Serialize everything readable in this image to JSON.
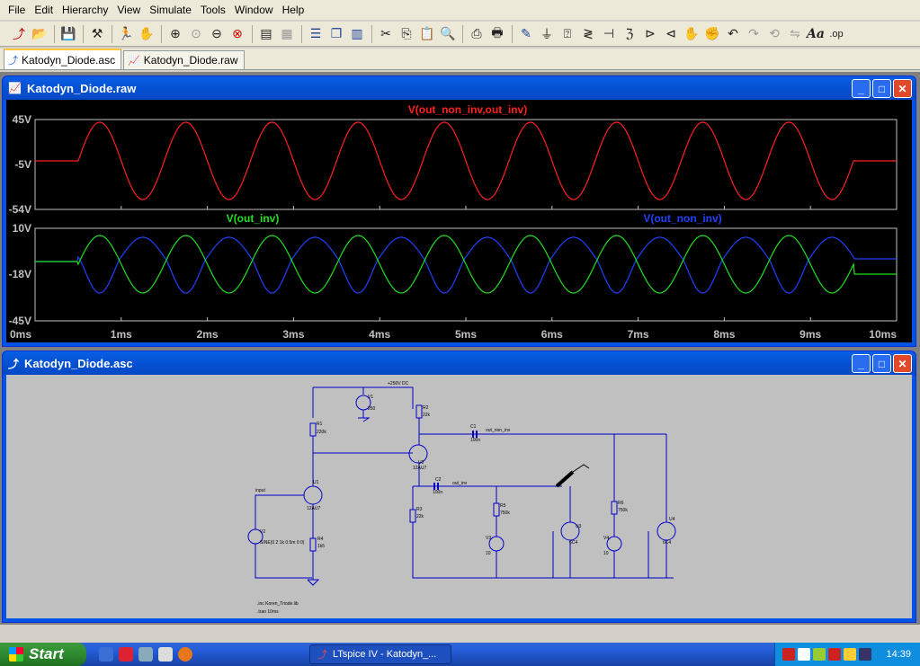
{
  "menu": [
    "File",
    "Edit",
    "Hierarchy",
    "View",
    "Simulate",
    "Tools",
    "Window",
    "Help"
  ],
  "toolbar_icons": [
    "new-schematic",
    "open",
    "save",
    "control-panel",
    "run",
    "halt",
    "zoom-in",
    "zoom-pan",
    "zoom-out",
    "zoom-cancel",
    "autorange",
    "mark-unref",
    "tile-horizontal",
    "cascade",
    "tile-vertical",
    "cut",
    "copy",
    "paste",
    "find",
    "print-setup",
    "print",
    "wire",
    "ground",
    "label-net",
    "resistor",
    "capacitor",
    "inductor",
    "diode",
    "component",
    "move",
    "drag",
    "undo",
    "redo",
    "rotate",
    "mirror",
    "text",
    "spice-directive"
  ],
  "tabs": [
    {
      "label": "Katodyn_Diode.asc",
      "active": true
    },
    {
      "label": "Katodyn_Diode.raw",
      "active": false
    }
  ],
  "plot_window": {
    "title": "Katodyn_Diode.raw",
    "pane1": {
      "trace": "V(out_non_inv,out_inv)",
      "color": "#ff2020",
      "ticks": [
        "45V",
        "-5V",
        "-54V"
      ]
    },
    "pane2": {
      "traces": [
        {
          "label": "V(out_inv)",
          "color": "#20e020"
        },
        {
          "label": "V(out_non_inv)",
          "color": "#2040ff"
        }
      ],
      "ticks": [
        "10V",
        "-18V",
        "-45V"
      ]
    },
    "x_ticks": [
      "0ms",
      "1ms",
      "2ms",
      "3ms",
      "4ms",
      "5ms",
      "6ms",
      "7ms",
      "8ms",
      "9ms",
      "10ms"
    ]
  },
  "chart_data": [
    {
      "type": "line",
      "series": [
        {
          "name": "V(out_non_inv,out_inv)",
          "x_ms": [
            0,
            0.5,
            1.0,
            10.0
          ],
          "note": "sine ~1kHz starting at 0.5ms"
        }
      ],
      "y_ticks": [
        "45V",
        "-5V",
        "-54V"
      ],
      "ylim": [
        -54,
        45
      ],
      "xlim_ms": [
        0,
        10
      ]
    },
    {
      "type": "line",
      "series": [
        {
          "name": "V(out_inv)"
        },
        {
          "name": "V(out_non_inv)"
        }
      ],
      "y_ticks": [
        "10V",
        "-18V",
        "-45V"
      ],
      "ylim": [
        -45,
        10
      ],
      "xlim_ms": [
        0,
        10
      ]
    }
  ],
  "schematic_window": {
    "title": "Katodyn_Diode.asc",
    "labels": {
      "supply": "+250V DC",
      "v1": "V1",
      "v1_val": "250",
      "r1": "R1",
      "r1_val": "220k",
      "r2": "R2",
      "r2_val": "22k",
      "c1": "C1",
      "c1_val": "100n",
      "out_non_inv": "out_non_inv",
      "out_inv": "out_inv",
      "u1": "U1",
      "u1_val": "12AU7",
      "u2": "U2",
      "u2_val": "12AU7",
      "c2": "C2",
      "c2_val": "100n",
      "r3": "R3",
      "r3_val": "22k",
      "r4": "R4",
      "r4_val": "1k5",
      "r5": "R5",
      "r5_val": "750k",
      "r6": "R6",
      "r6_val": "750k",
      "v2": "V2",
      "v2_val": "SINE(0 2 1k 0.5m 0 0)",
      "v3": "V3",
      "v3_val": "10",
      "v4": "V4",
      "v4_val": "10",
      "u3": "U3",
      "u3_val": "6C4",
      "u4": "U4",
      "u4_val": "6C4",
      "inp": "input",
      "tran": ".tran 10ms",
      "inc": ".inc Koren_Triode.lib"
    }
  },
  "taskbar": {
    "start": "Start",
    "task": "LTspice IV - Katodyn_...",
    "clock": "14:39"
  }
}
